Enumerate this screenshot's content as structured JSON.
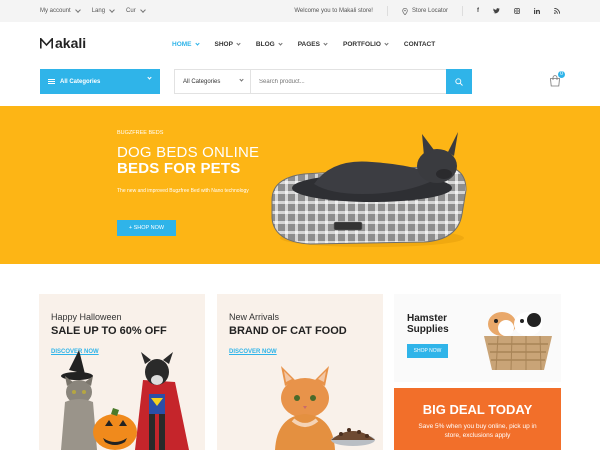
{
  "topbar": {
    "account": "My account",
    "lang": "Lang",
    "currency": "Cur",
    "welcome": "Welcome you to Makali store!",
    "store_locator": "Store Locator",
    "social": [
      "f",
      "t",
      "ig",
      "in",
      "rss"
    ]
  },
  "header": {
    "logo": "akali",
    "nav": [
      {
        "label": "HOME",
        "active": true
      },
      {
        "label": "SHOP"
      },
      {
        "label": "BLOG"
      },
      {
        "label": "PAGES"
      },
      {
        "label": "PORTFOLIO"
      },
      {
        "label": "CONTACT"
      }
    ]
  },
  "search": {
    "categories_button": "All Categories",
    "category_select": "All Categories",
    "placeholder": "Search product...",
    "cart_count": "0"
  },
  "hero": {
    "kicker": "BUGZFREE BEDS",
    "title_line1": "DOG BEDS ONLINE",
    "title_line2": "BEDS FOR PETS",
    "subtitle": "The new and improved Bugzfree Bed with Nano technology",
    "cta": "+ SHOP NOW"
  },
  "promos": {
    "card1": {
      "small": "Happy Halloween",
      "big": "SALE UP TO 60% OFF",
      "link": "DISCOVER NOW"
    },
    "card2": {
      "small": "New Arrivals",
      "big": "BRAND OF CAT FOOD",
      "link": "DISCOVER NOW"
    },
    "card3": {
      "title_line1": "Hamster",
      "title_line2": "Supplies",
      "button": "SHOP NOW"
    },
    "card4": {
      "title": "BIG DEAL TODAY",
      "text": "Save 5% when you buy online, pick up in store, exclusions apply"
    }
  },
  "colors": {
    "accent": "#2fb4e9",
    "hero_bg": "#fdb515",
    "deal_bg": "#f26f2a"
  }
}
